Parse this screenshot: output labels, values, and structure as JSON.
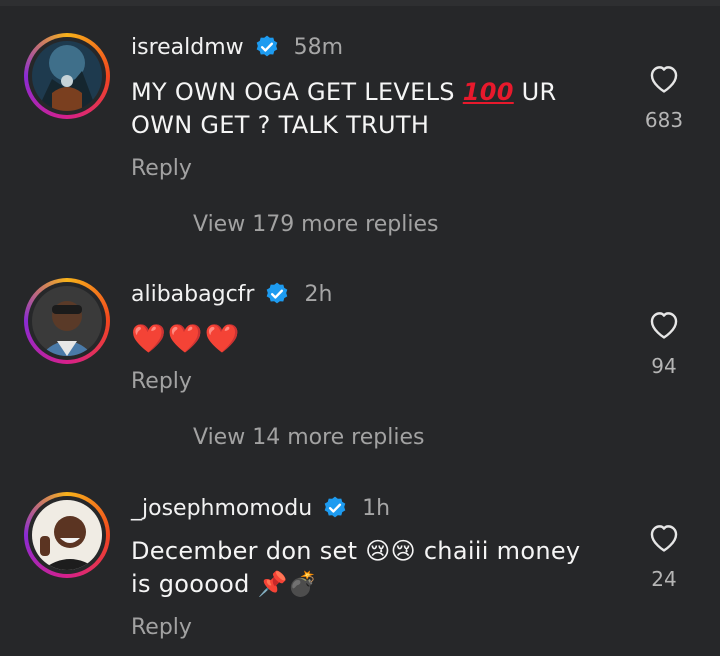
{
  "comments": [
    {
      "username": "isrealdmw",
      "time": "58m",
      "text": "MY OWN OGA GET LEVELS",
      "emoji_after_text": "💯",
      "text_cont": " UR OWN GET ? TALK TRUTH",
      "likes": "683",
      "reply_label": "Reply",
      "view_replies": "View 179 more replies"
    },
    {
      "username": "alibabagcfr",
      "time": "2h",
      "text": "❤️❤️❤️",
      "likes": "94",
      "reply_label": "Reply",
      "view_replies": "View 14 more replies"
    },
    {
      "username": "_josephmomodu",
      "time": "1h",
      "text": "December don set 😢😢 chaiii money is gooood 📌💣",
      "likes": "24",
      "reply_label": "Reply"
    }
  ],
  "colors": {
    "background": "#262729",
    "verified": "#1d9bf0",
    "secondary_text": "#a2a2a2",
    "heart_red": "#e8192c"
  },
  "icons": [
    "verified-badge-icon",
    "heart-outline-icon",
    "hundred-points-icon",
    "crying-face-icon",
    "pushpin-icon",
    "bomb-icon"
  ]
}
